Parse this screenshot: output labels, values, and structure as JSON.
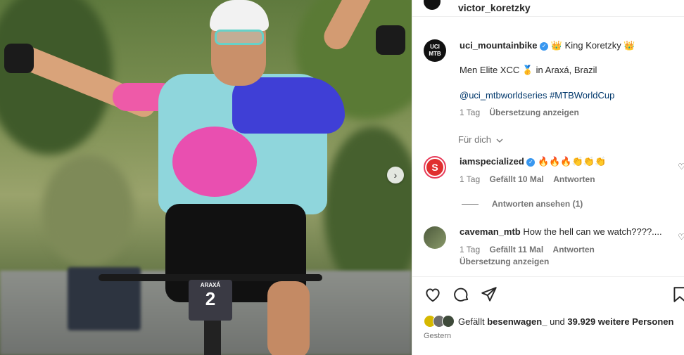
{
  "post": {
    "author": "victor_koretzky",
    "bib_top": "ARAXÁ",
    "bib_number": "2"
  },
  "caption": {
    "username": "uci_mountainbike",
    "line1": "👑 King Koretzky 👑",
    "line2": "Men Elite XCC 🥇 in Araxá, Brazil",
    "tags": "@uci_mtbworldseries #MTBWorldCup",
    "time": "1 Tag",
    "translate": "Übersetzung anzeigen",
    "avatar_text_top": "UCI",
    "avatar_text_bottom": "MTB"
  },
  "fuer_dich": "Für dich",
  "comments": [
    {
      "username": "iamspecialized",
      "text": "🔥🔥🔥👏👏👏",
      "time": "1 Tag",
      "likes": "Gefällt 10 Mal",
      "reply": "Antworten",
      "view_replies": "Antworten ansehen (1)"
    },
    {
      "username": "caveman_mtb",
      "text": "How the hell can we watch????....",
      "time": "1 Tag",
      "likes": "Gefällt 11 Mal",
      "reply": "Antworten",
      "translate": "Übersetzung anzeigen"
    }
  ],
  "likes": {
    "prefix": "Gefällt",
    "user": "besenwagen_",
    "middle": "und",
    "others": "39.929 weitere Personen"
  },
  "date": "Gestern",
  "icons": {
    "heart": "heart-icon",
    "comment": "comment-icon",
    "share": "share-icon",
    "bookmark": "bookmark-icon",
    "next": "chevron-right-icon"
  },
  "colors": {
    "link": "#00376b",
    "verified": "#3897f0",
    "secondary_text": "#737373"
  }
}
